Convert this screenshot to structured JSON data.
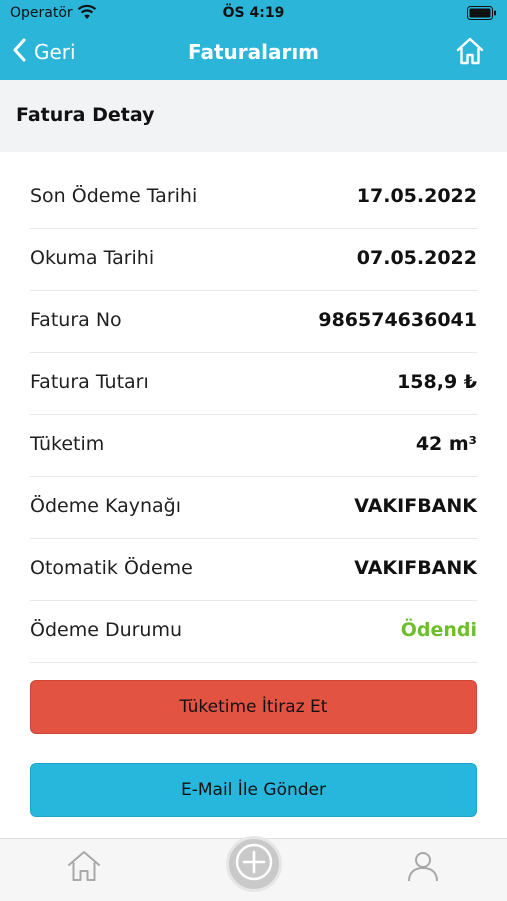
{
  "status": {
    "carrier": "Operatör",
    "time": "ÖS 4:19"
  },
  "nav": {
    "back_label": "Geri",
    "title": "Faturalarım"
  },
  "section": {
    "title": "Fatura Detay"
  },
  "details": [
    {
      "label": "Son Ödeme Tarihi",
      "value": "17.05.2022"
    },
    {
      "label": "Okuma Tarihi",
      "value": "07.05.2022"
    },
    {
      "label": "Fatura No",
      "value": "986574636041"
    },
    {
      "label": "Fatura Tutarı",
      "value": "158,9 ₺"
    },
    {
      "label": "Tüketim",
      "value": "42 m³"
    },
    {
      "label": "Ödeme Kaynağı",
      "value": "VAKIFBANK"
    },
    {
      "label": "Otomatik Ödeme",
      "value": "VAKIFBANK"
    },
    {
      "label": "Ödeme Durumu",
      "value": "Ödendi"
    }
  ],
  "actions": {
    "objection_label": "Tüketime İtiraz Et",
    "email_label": "E-Mail İle Gönder"
  },
  "colors": {
    "primary": "#2bb5d9",
    "danger": "#e35342",
    "paid": "#6cbf2a"
  },
  "tabbar": {
    "icons": [
      "home-icon",
      "add-icon",
      "user-icon"
    ]
  }
}
